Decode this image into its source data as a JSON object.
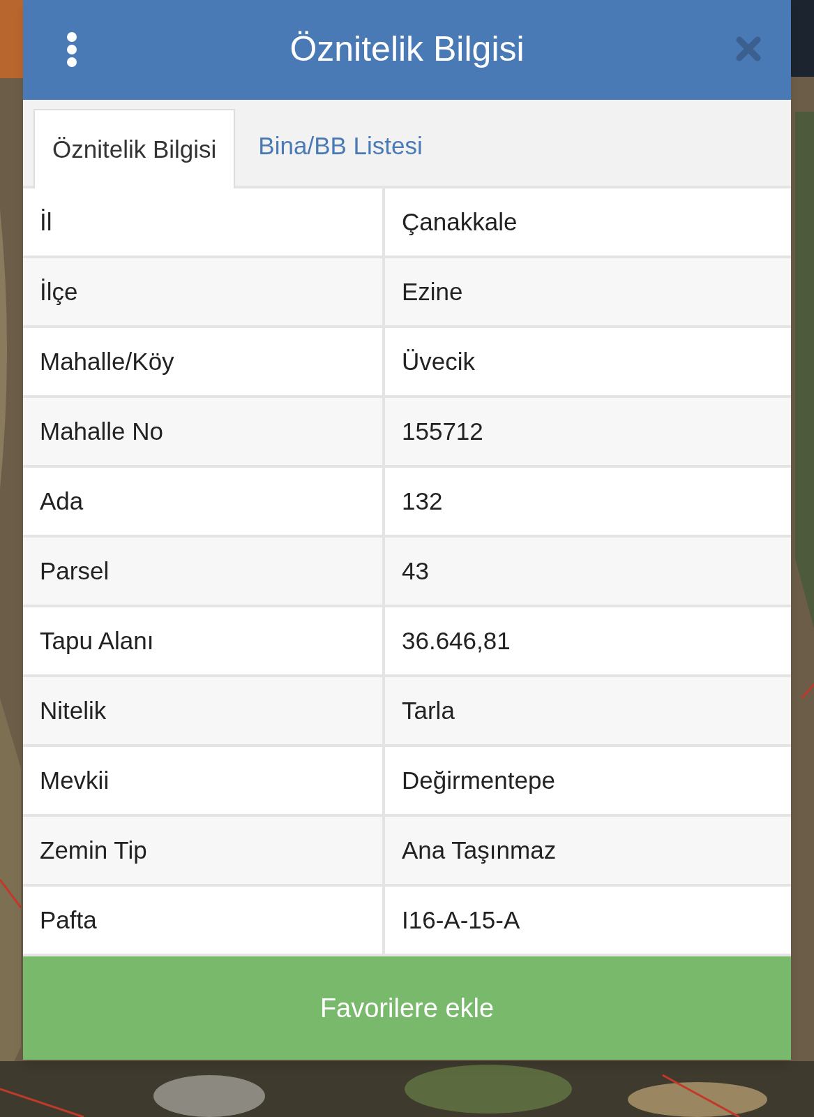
{
  "dialog": {
    "title": "Öznitelik Bilgisi"
  },
  "tabs": [
    {
      "label": "Öznitelik Bilgisi",
      "selected": true
    },
    {
      "label": "Bina/BB Listesi",
      "selected": false
    }
  ],
  "rows": [
    {
      "label": "İl",
      "value": "Çanakkale"
    },
    {
      "label": "İlçe",
      "value": "Ezine"
    },
    {
      "label": "Mahalle/Köy",
      "value": "Üvecik"
    },
    {
      "label": "Mahalle No",
      "value": "155712"
    },
    {
      "label": "Ada",
      "value": "132"
    },
    {
      "label": "Parsel",
      "value": "43"
    },
    {
      "label": "Tapu Alanı",
      "value": "36.646,81"
    },
    {
      "label": "Nitelik",
      "value": "Tarla"
    },
    {
      "label": "Mevkii",
      "value": "Değirmentepe"
    },
    {
      "label": "Zemin Tip",
      "value": "Ana Taşınmaz"
    },
    {
      "label": "Pafta",
      "value": "I16-A-15-A"
    }
  ],
  "button": {
    "label": "Favorilere ekle"
  }
}
